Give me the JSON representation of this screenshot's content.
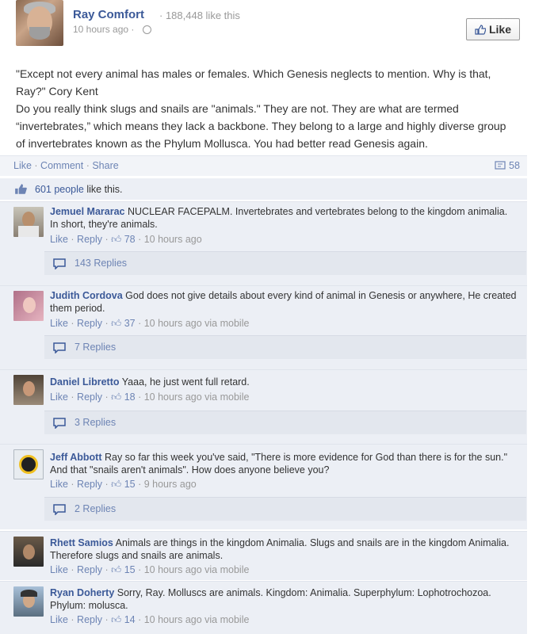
{
  "post": {
    "page_name": "Ray Comfort",
    "page_likes": "· 188,448 like this",
    "time": "10 hours ago ·",
    "like_button": "Like",
    "body_line1": "\"Except not every animal has males or females. Which Genesis neglects to mention. Why is that, Ray?\" Cory Kent",
    "body_line2": "Do you really think slugs and snails are \"animals.\" They are not. They are what are termed “invertebrates,” which means they lack a backbone. They belong to a large and highly diverse group of invertebrates known as the Phylum Mollusca. You had better read Genesis again."
  },
  "actions": {
    "like": "Like",
    "comment": "Comment",
    "share": "Share",
    "sep": " · ",
    "comment_count": "58"
  },
  "likes": {
    "count": "601 people",
    "suffix": " like this."
  },
  "comments": [
    {
      "author": "Jemuel Mararac",
      "text": " NUCLEAR FACEPALM. Invertebrates and vertebrates belong to the kingdom animalia. In short, they're animals.",
      "like": "Like",
      "reply": "Reply",
      "likes": "78",
      "time": "10 hours ago",
      "replies": "143 Replies"
    },
    {
      "author": "Judith Cordova",
      "text": " God does not give details about every kind of animal in Genesis or anywhere, He created them period.",
      "like": "Like",
      "reply": "Reply",
      "likes": "37",
      "time": "10 hours ago via mobile",
      "replies": "7 Replies"
    },
    {
      "author": "Daniel Libretto",
      "text": " Yaaa, he just went full retard.",
      "like": "Like",
      "reply": "Reply",
      "likes": "18",
      "time": "10 hours ago via mobile",
      "replies": "3 Replies"
    },
    {
      "author": "Jeff Abbott",
      "text": " Ray so far this week you've said, \"There is more evidence for God than there is for the sun.\" And that \"snails aren't animals\". How does anyone believe you?",
      "like": "Like",
      "reply": "Reply",
      "likes": "15",
      "time": "9 hours ago",
      "replies": "2 Replies"
    },
    {
      "author": "Rhett Samios",
      "text": " Animals are things in the kingdom Animalia. Slugs and snails are in the kingdom Animalia. Therefore slugs and snails are animals.",
      "like": "Like",
      "reply": "Reply",
      "likes": "15",
      "time": "10 hours ago via mobile"
    },
    {
      "author": "Ryan Doherty",
      "text": " Sorry, Ray. Molluscs are animals. Kingdom: Animalia. Superphylum: Lophotrochozoa. Phylum: molusca.",
      "like": "Like",
      "reply": "Reply",
      "likes": "14",
      "time": "10 hours ago via mobile"
    }
  ],
  "colors": {
    "link": "#3b5998",
    "meta_link": "#6d84b4",
    "comment_bg": "#eceff5"
  }
}
